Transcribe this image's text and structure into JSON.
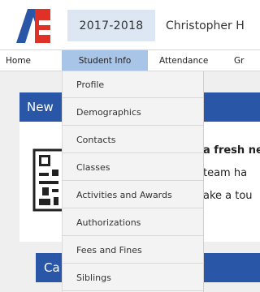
{
  "header": {
    "year": "2017-2018",
    "user_name": "Christopher H"
  },
  "nav": {
    "home": "Home",
    "student_info": "Student Info",
    "attendance": "Attendance",
    "grades_partial": "Gr"
  },
  "panel": {
    "title_partial": "New",
    "line1": "a fresh ne",
    "line2": "team ha",
    "line3": "ake a tou"
  },
  "second_panel": {
    "title_partial": "Ca"
  },
  "dropdown": {
    "items": [
      "Profile",
      "Demographics",
      "Contacts",
      "Classes",
      "Activities and Awards",
      "Authorizations",
      "Fees and Fines",
      "Siblings"
    ]
  },
  "colors": {
    "brand_blue": "#2a56a8",
    "logo_red": "#e03127",
    "active_nav": "#a8c4e6",
    "year_tab": "#dce7f3"
  }
}
